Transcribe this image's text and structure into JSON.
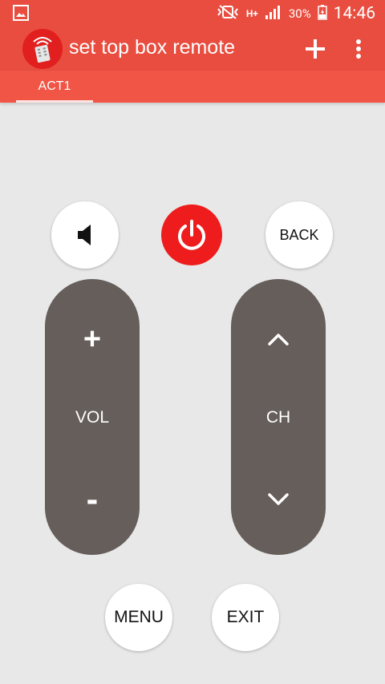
{
  "status_bar": {
    "battery": "30%",
    "time": "14:46",
    "network": "H+"
  },
  "app_bar": {
    "title": "set top box remote",
    "add_icon": "plus-icon",
    "menu_icon": "overflow-menu-icon"
  },
  "tabs": [
    {
      "label": "ACT1",
      "selected": true
    }
  ],
  "remote": {
    "mute_icon": "speaker-icon",
    "power_icon": "power-icon",
    "back_label": "BACK",
    "vol": {
      "plus": "+",
      "label": "VOL",
      "minus": "-"
    },
    "ch": {
      "up_icon": "chevron-up-icon",
      "label": "CH",
      "down_icon": "chevron-down-icon"
    },
    "menu_label": "MENU",
    "exit_label": "EXIT"
  },
  "colors": {
    "primary": "#e84d3f",
    "tab_bar": "#f05545",
    "power": "#ee1c1c",
    "pill": "#655e5b",
    "background": "#e8e8e8"
  }
}
